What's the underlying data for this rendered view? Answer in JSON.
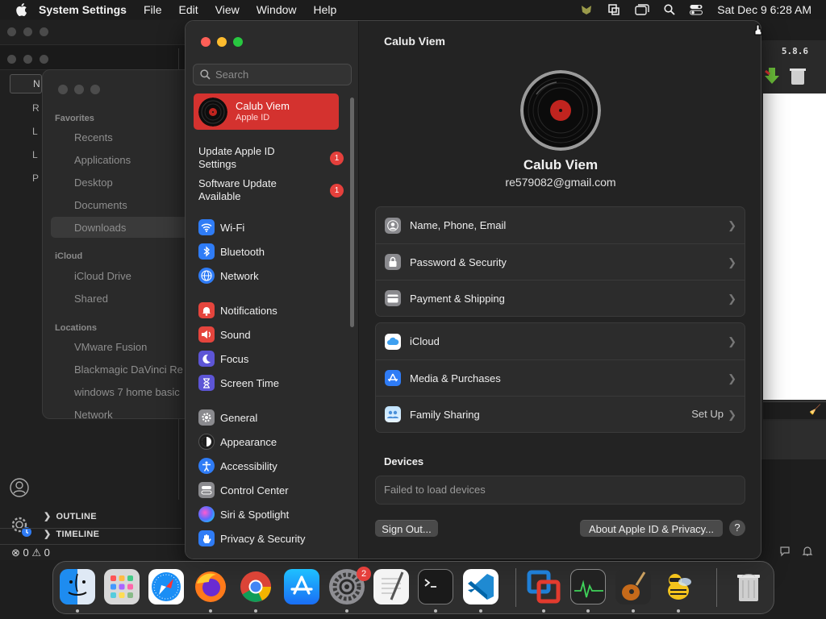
{
  "menubar": {
    "app_name": "System Settings",
    "items": [
      "File",
      "Edit",
      "View",
      "Window",
      "Help"
    ],
    "clock": "Sat Dec 9  6:28 AM"
  },
  "bg_editor": {
    "side_letters": [
      "N",
      "R",
      "L",
      "L",
      "P"
    ],
    "sections": [
      "OUTLINE",
      "TIMELINE"
    ],
    "status": "⊗ 0 ⚠ 0"
  },
  "finder": {
    "favorites_label": "Favorites",
    "favorites": [
      "Recents",
      "Applications",
      "Desktop",
      "Documents",
      "Downloads"
    ],
    "icloud_label": "iCloud",
    "icloud": [
      "iCloud Drive",
      "Shared"
    ],
    "locations_label": "Locations",
    "locations": [
      "VMware Fusion",
      "Blackmagic DaVinci Re",
      "windows 7 home basic",
      "Network"
    ]
  },
  "bg_right": {
    "version": "5.8.6"
  },
  "settings": {
    "search_placeholder": "Search",
    "profile": {
      "name": "Calub Viem",
      "subtitle": "Apple ID"
    },
    "notices": [
      {
        "label": "Update Apple ID Settings",
        "badge": "1"
      },
      {
        "label": "Software Update Available",
        "badge": "1"
      }
    ],
    "sidebar_items": [
      {
        "label": "Wi-Fi",
        "icon": "wifi-icon",
        "color": "#2f7cf6"
      },
      {
        "label": "Bluetooth",
        "icon": "bluetooth-icon",
        "color": "#2f7cf6"
      },
      {
        "label": "Network",
        "icon": "globe-icon",
        "color": "#2f7cf6"
      },
      {
        "label": "Notifications",
        "icon": "bell-icon",
        "color": "#e5453d"
      },
      {
        "label": "Sound",
        "icon": "speaker-icon",
        "color": "#e5453d"
      },
      {
        "label": "Focus",
        "icon": "moon-icon",
        "color": "#5d55d6"
      },
      {
        "label": "Screen Time",
        "icon": "hourglass-icon",
        "color": "#5d55d6"
      },
      {
        "label": "General",
        "icon": "gear-icon",
        "color": "#8a8a8e"
      },
      {
        "label": "Appearance",
        "icon": "appearance-icon",
        "color": "#1d1d1d"
      },
      {
        "label": "Accessibility",
        "icon": "accessibility-icon",
        "color": "#2f7cf6"
      },
      {
        "label": "Control Center",
        "icon": "control-center-icon",
        "color": "#8a8a8e"
      },
      {
        "label": "Siri & Spotlight",
        "icon": "siri-icon",
        "color": "#333"
      },
      {
        "label": "Privacy & Security",
        "icon": "hand-icon",
        "color": "#2f7cf6"
      }
    ],
    "content": {
      "title": "Calub Viem",
      "name": "Calub Viem",
      "email": "re579082@gmail.com",
      "group1": [
        {
          "label": "Name, Phone, Email",
          "icon": "person-icon"
        },
        {
          "label": "Password & Security",
          "icon": "lock-icon"
        },
        {
          "label": "Payment & Shipping",
          "icon": "card-icon"
        }
      ],
      "group2": [
        {
          "label": "iCloud",
          "icon": "cloud-icon",
          "value": ""
        },
        {
          "label": "Media & Purchases",
          "icon": "app-store-icon",
          "value": ""
        },
        {
          "label": "Family Sharing",
          "icon": "family-icon",
          "value": "Set Up"
        }
      ],
      "devices_heading": "Devices",
      "devices_status": "Failed to load devices",
      "sign_out": "Sign Out...",
      "about": "About Apple ID & Privacy...",
      "help": "?"
    }
  },
  "dock": {
    "apps": [
      "Finder",
      "Launchpad",
      "Safari",
      "Firefox",
      "Chrome",
      "App Store",
      "System Settings",
      "TextEdit",
      "Terminal",
      "VS Code",
      "VMware Fusion",
      "Activity Monitor",
      "GarageBand",
      "Cyberduck",
      "Trash"
    ],
    "settings_badge": "2"
  }
}
